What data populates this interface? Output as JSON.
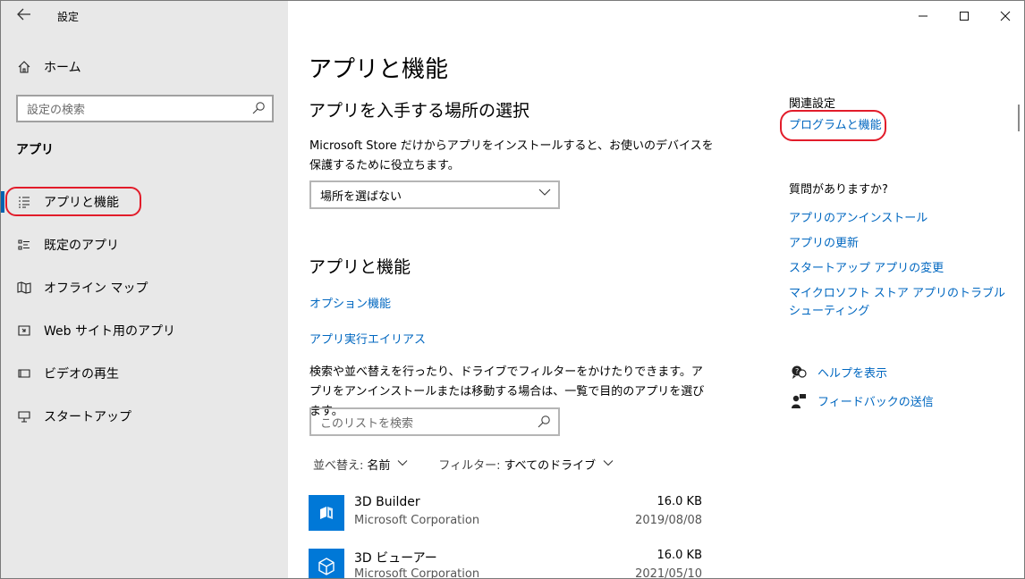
{
  "window": {
    "title": "設定"
  },
  "sidebar": {
    "home_label": "ホーム",
    "search_placeholder": "設定の検索",
    "section_title": "アプリ",
    "items": [
      {
        "label": "アプリと機能",
        "icon": "apps-features-icon"
      },
      {
        "label": "既定のアプリ",
        "icon": "default-apps-icon"
      },
      {
        "label": "オフライン マップ",
        "icon": "offline-maps-icon"
      },
      {
        "label": "Web サイト用のアプリ",
        "icon": "apps-for-websites-icon"
      },
      {
        "label": "ビデオの再生",
        "icon": "video-playback-icon"
      },
      {
        "label": "スタートアップ",
        "icon": "startup-icon"
      }
    ]
  },
  "main": {
    "page_title": "アプリと機能",
    "source_section": {
      "heading": "アプリを入手する場所の選択",
      "description": "Microsoft Store だけからアプリをインストールすると、お使いのデバイスを保護するために役立ちます。",
      "dropdown_value": "場所を選ばない"
    },
    "apps_section": {
      "heading": "アプリと機能",
      "optional_features_link": "オプション機能",
      "app_aliases_link": "アプリ実行エイリアス",
      "description": "検索や並べ替えを行ったり、ドライブでフィルターをかけたりできます。アプリをアンインストールまたは移動する場合は、一覧で目的のアプリを選びます。",
      "list_search_placeholder": "このリストを検索",
      "sort_label": "並べ替え:",
      "sort_value": "名前",
      "filter_label": "フィルター:",
      "filter_value": "すべてのドライブ"
    },
    "apps": [
      {
        "name": "3D Builder",
        "publisher": "Microsoft Corporation",
        "size": "16.0 KB",
        "date": "2019/08/08"
      },
      {
        "name": "3D ビューアー",
        "publisher": "Microsoft Corporation",
        "size": "16.0 KB",
        "date": "2021/05/10"
      }
    ]
  },
  "related": {
    "heading": "関連設定",
    "programs_link": "プログラムと機能",
    "questions_heading": "質問がありますか?",
    "links": [
      "アプリのアンインストール",
      "アプリの更新",
      "スタートアップ アプリの変更",
      "マイクロソフト ストア アプリのトラブルシューティング"
    ],
    "help_link": "ヘルプを表示",
    "feedback_link": "フィードバックの送信"
  },
  "colors": {
    "accent": "#0067c0",
    "sidebar_bg": "#e8e8e8",
    "highlight_oval": "#e21c2a",
    "app_tile": "#0078d7"
  }
}
